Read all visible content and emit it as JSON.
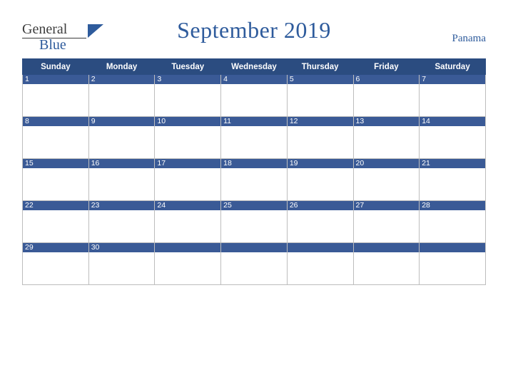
{
  "logo": {
    "word1": "General",
    "word2": "Blue",
    "triangle_color": "#2e5b9c"
  },
  "header": {
    "title": "September 2019",
    "country": "Panama",
    "accent_color": "#2e5b9c",
    "header_bg": "#2b4c80",
    "daynum_bg": "#3a5a96"
  },
  "calendar": {
    "weekdays": [
      "Sunday",
      "Monday",
      "Tuesday",
      "Wednesday",
      "Thursday",
      "Friday",
      "Saturday"
    ],
    "weeks": [
      [
        {
          "day": "1"
        },
        {
          "day": "2"
        },
        {
          "day": "3"
        },
        {
          "day": "4"
        },
        {
          "day": "5"
        },
        {
          "day": "6"
        },
        {
          "day": "7"
        }
      ],
      [
        {
          "day": "8"
        },
        {
          "day": "9"
        },
        {
          "day": "10"
        },
        {
          "day": "11"
        },
        {
          "day": "12"
        },
        {
          "day": "13"
        },
        {
          "day": "14"
        }
      ],
      [
        {
          "day": "15"
        },
        {
          "day": "16"
        },
        {
          "day": "17"
        },
        {
          "day": "18"
        },
        {
          "day": "19"
        },
        {
          "day": "20"
        },
        {
          "day": "21"
        }
      ],
      [
        {
          "day": "22"
        },
        {
          "day": "23"
        },
        {
          "day": "24"
        },
        {
          "day": "25"
        },
        {
          "day": "26"
        },
        {
          "day": "27"
        },
        {
          "day": "28"
        }
      ],
      [
        {
          "day": "29"
        },
        {
          "day": "30"
        },
        {
          "day": ""
        },
        {
          "day": ""
        },
        {
          "day": ""
        },
        {
          "day": ""
        },
        {
          "day": ""
        }
      ]
    ]
  }
}
